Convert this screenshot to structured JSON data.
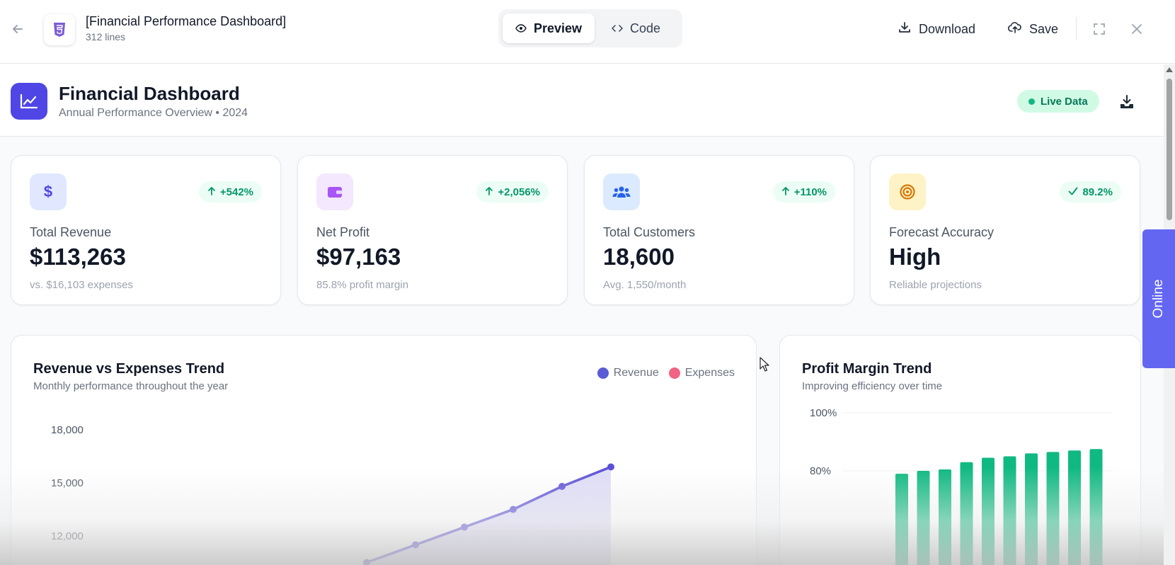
{
  "topbar": {
    "file_title": "[Financial Performance Dashboard]",
    "file_meta": "312 lines",
    "file_icon": "html5-icon",
    "view_toggle": {
      "preview_label": "Preview",
      "code_label": "Code",
      "active": "Preview"
    },
    "download_label": "Download",
    "save_label": "Save"
  },
  "dashboard": {
    "title": "Financial Dashboard",
    "subtitle": "Annual Performance Overview • 2024",
    "live_badge": "Live Data",
    "accent_color": "#4f46e5"
  },
  "stats": [
    {
      "icon": "dollar-icon",
      "badge": "+542%",
      "label": "Total Revenue",
      "value": "$113,263",
      "note": "vs. $16,103 expenses"
    },
    {
      "icon": "wallet-icon",
      "badge": "+2,056%",
      "label": "Net Profit",
      "value": "$97,163",
      "note": "85.8% profit margin"
    },
    {
      "icon": "users-icon",
      "badge": "+110%",
      "label": "Total Customers",
      "value": "18,600",
      "note": "Avg. 1,550/month"
    },
    {
      "icon": "target-icon",
      "badge": "89.2%",
      "label": "Forecast Accuracy",
      "value": "High",
      "note": "Reliable projections"
    }
  ],
  "revenue_chart": {
    "title": "Revenue vs Expenses Trend",
    "subtitle": "Monthly performance throughout the year",
    "legend": [
      "Revenue",
      "Expenses"
    ]
  },
  "margin_chart": {
    "title": "Profit Margin Trend",
    "subtitle": "Improving efficiency over time"
  },
  "chart_data": [
    {
      "type": "line",
      "title": "Revenue vs Expenses Trend",
      "ylim": [
        10000,
        19000
      ],
      "y_ticks": [
        "18,000",
        "15,000",
        "12,000"
      ],
      "series": [
        {
          "name": "Revenue",
          "color": "#5b4fd6",
          "values_visible": [
            10500,
            11500,
            12500,
            13500,
            14800,
            15900
          ]
        }
      ],
      "grid": false
    },
    {
      "type": "bar",
      "title": "Profit Margin Trend",
      "ylim": [
        70,
        100
      ],
      "y_ticks": [
        "100%",
        "80%"
      ],
      "series": [
        {
          "name": "Profit Margin",
          "color": "#10b981",
          "values_visible": [
            79,
            80,
            80.5,
            83,
            84.5,
            85,
            86,
            86.5,
            87,
            87.5
          ]
        }
      ],
      "grid": true
    }
  ],
  "side_tab": "Online"
}
